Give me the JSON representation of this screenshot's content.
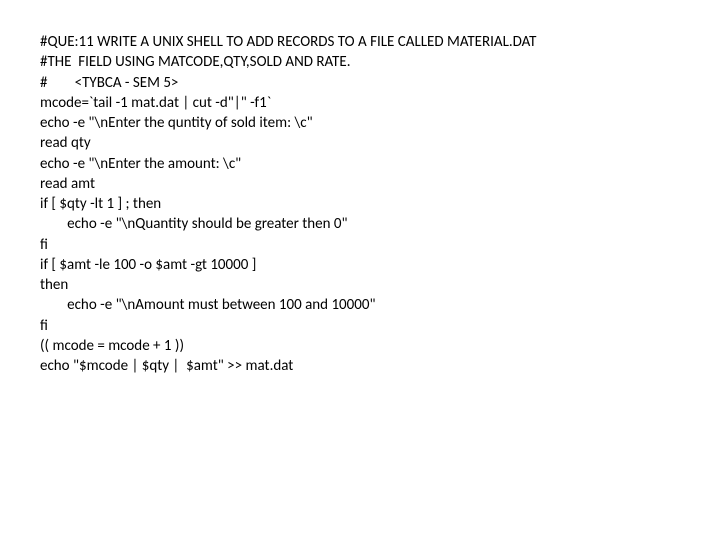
{
  "lines": [
    "#QUE:11 WRITE A UNIX SHELL TO ADD RECORDS TO A FILE CALLED MATERIAL.DAT",
    "#THE  FIELD USING MATCODE,QTY,SOLD AND RATE.",
    "#        <TYBCA - SEM 5>",
    "mcode=`tail -1 mat.dat | cut -d\"|\" -f1`",
    "echo -e \"\\nEnter the quntity of sold item: \\c\"",
    "read qty",
    "echo -e \"\\nEnter the amount: \\c\"",
    "read amt",
    "if [ $qty -lt 1 ] ; then",
    "        echo -e \"\\nQuantity should be greater then 0\"",
    "fi",
    "if [ $amt -le 100 -o $amt -gt 10000 ]",
    "then",
    "        echo -e \"\\nAmount must between 100 and 10000\"",
    "fi",
    "(( mcode = mcode + 1 ))",
    "echo \"$mcode | $qty |  $amt\" >> mat.dat"
  ]
}
